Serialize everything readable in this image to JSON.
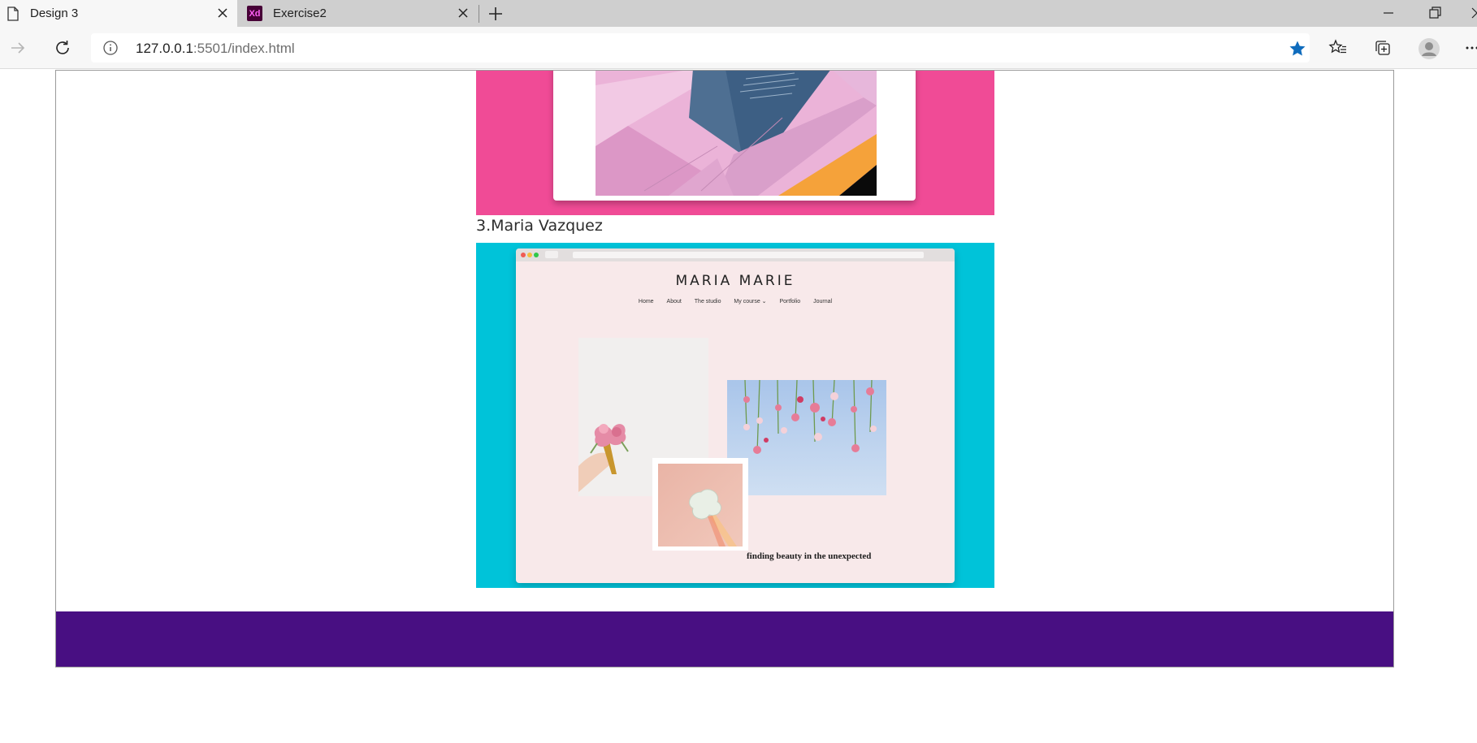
{
  "browser": {
    "tabs": [
      {
        "title": "Design 3",
        "active": true,
        "icon": "page-icon"
      },
      {
        "title": "Exercise2",
        "active": false,
        "icon": "xd-icon",
        "badge": "Xd"
      }
    ],
    "address": {
      "host": "127.0.0.1",
      "path": ":5501/index.html"
    }
  },
  "page": {
    "item3_heading": "3.Maria Vazquez",
    "mock_site": {
      "brand": "MARIA MARIE",
      "nav": [
        "Home",
        "About",
        "The studio",
        "My course ⌄",
        "Portfolio",
        "Journal"
      ],
      "tagline": "finding beauty in the unexpected"
    },
    "colors": {
      "pink_card": "#f04b96",
      "cyan_card": "#00c3d9",
      "footer": "#480f82",
      "favorite_star": "#0f6cbd"
    }
  }
}
